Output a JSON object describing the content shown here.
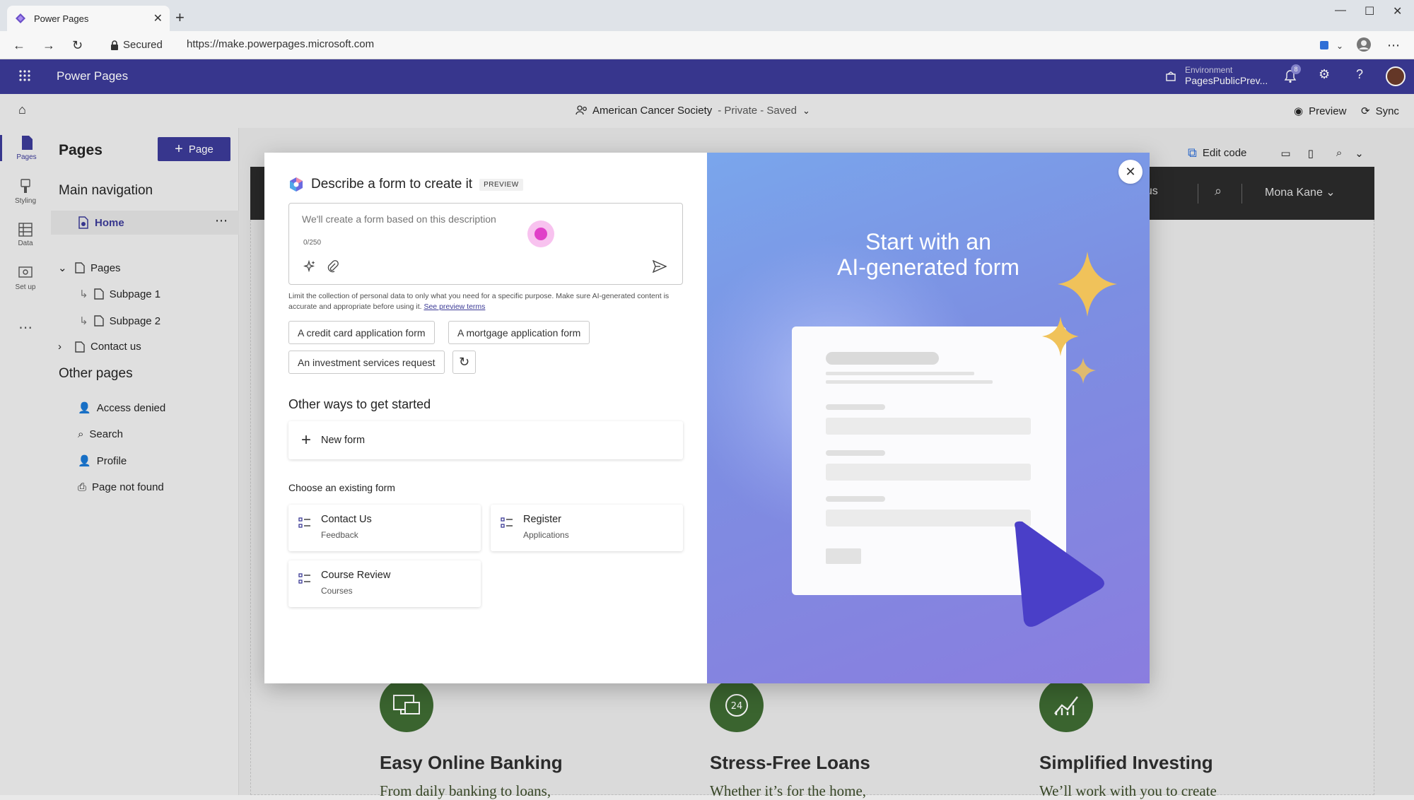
{
  "browser": {
    "tab_title": "Power Pages",
    "secured_label": "Secured",
    "url": "https://make.powerpages.microsoft.com"
  },
  "app": {
    "title": "Power Pages",
    "environment_label": "Environment",
    "environment_value": "PagesPublicPrev...",
    "notification_count": "8"
  },
  "command_bar": {
    "site_name": "American Cancer Society",
    "site_status": "- Private - Saved",
    "preview_label": "Preview",
    "sync_label": "Sync"
  },
  "rail": {
    "items": [
      {
        "label": "Pages"
      },
      {
        "label": "Styling"
      },
      {
        "label": "Data"
      },
      {
        "label": "Set up"
      }
    ]
  },
  "pages_panel": {
    "title": "Pages",
    "add_page_label": "Page",
    "main_nav_title": "Main navigation",
    "items": [
      {
        "label": "Home"
      },
      {
        "label": "Pages"
      },
      {
        "label": "Subpage 1"
      },
      {
        "label": "Subpage 2"
      },
      {
        "label": "Contact us"
      }
    ],
    "other_pages_title": "Other pages",
    "other_items": [
      {
        "label": "Access denied"
      },
      {
        "label": "Search"
      },
      {
        "label": "Profile"
      },
      {
        "label": "Page not found"
      }
    ]
  },
  "canvas": {
    "edit_code_label": "Edit code",
    "site_nav_link": "ct us",
    "site_user": "Mona Kane",
    "features": [
      {
        "title": "Easy Online Banking",
        "text": "From daily banking to loans,"
      },
      {
        "title": "Stress-Free Loans",
        "text": "Whether it’s for the home,"
      },
      {
        "title": "Simplified Investing",
        "text": "We’ll work with you to create"
      }
    ]
  },
  "dialog": {
    "title": "Describe a form to create it",
    "badge": "PREVIEW",
    "prompt_placeholder": "We'll create a form based on this description",
    "char_count": "0/250",
    "disclaimer": "Limit the collection of personal data to only what you need for a specific purpose. Make sure AI-generated content is accurate and appropriate before using it.",
    "preview_terms_link": "See preview terms",
    "suggestions": [
      "A credit card application form",
      "A mortgage application form",
      "An investment services request"
    ],
    "other_ways_title": "Other ways to get started",
    "new_form_label": "New form",
    "choose_existing_title": "Choose an existing form",
    "existing_forms": [
      {
        "name": "Contact Us",
        "table": "Feedback"
      },
      {
        "name": "Register",
        "table": "Applications"
      },
      {
        "name": "Course Review",
        "table": "Courses"
      }
    ],
    "hero_title_line1": "Start with an",
    "hero_title_line2": "AI-generated form"
  },
  "colors": {
    "brand": "#3b3a96",
    "feature_icon_bg": "#3e6b32"
  }
}
